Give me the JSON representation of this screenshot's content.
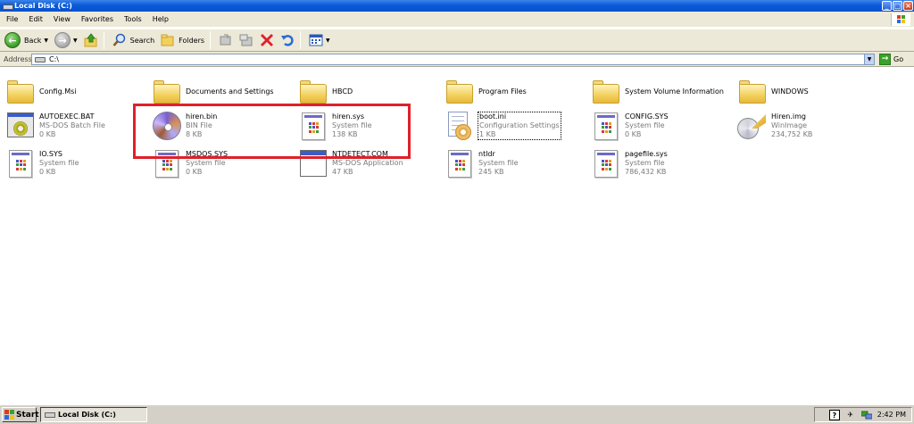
{
  "window": {
    "title": "Local Disk (C:)"
  },
  "menu": [
    "File",
    "Edit",
    "View",
    "Favorites",
    "Tools",
    "Help"
  ],
  "toolbar": {
    "back_label": "Back",
    "search_label": "Search",
    "folders_label": "Folders"
  },
  "address": {
    "label": "Address",
    "value": "C:\\",
    "go_label": "Go"
  },
  "folders": [
    {
      "name": "Config.Msi"
    },
    {
      "name": "Documents and Settings"
    },
    {
      "name": "HBCD"
    },
    {
      "name": "Program Files"
    },
    {
      "name": "System Volume Information"
    },
    {
      "name": "WINDOWS"
    }
  ],
  "files": [
    {
      "name": "AUTOEXEC.BAT",
      "type": "MS-DOS Batch File",
      "size": "0 KB",
      "icon": "batch-file-icon"
    },
    {
      "name": "hiren.bin",
      "type": "BIN File",
      "size": "8 KB",
      "icon": "disc-image-icon"
    },
    {
      "name": "hiren.sys",
      "type": "System file",
      "size": "138 KB",
      "icon": "system-file-icon"
    },
    {
      "name": "boot.ini",
      "type": "Configuration Settings",
      "size": "1 KB",
      "icon": "config-file-icon"
    },
    {
      "name": "CONFIG.SYS",
      "type": "System file",
      "size": "0 KB",
      "icon": "system-file-icon"
    },
    {
      "name": "Hiren.img",
      "type": "WinImage",
      "size": "234,752 KB",
      "icon": "winimage-icon"
    },
    {
      "name": "IO.SYS",
      "type": "System file",
      "size": "0 KB",
      "icon": "system-file-icon"
    },
    {
      "name": "MSDOS.SYS",
      "type": "System file",
      "size": "0 KB",
      "icon": "system-file-icon"
    },
    {
      "name": "NTDETECT.COM",
      "type": "MS-DOS Application",
      "size": "47 KB",
      "icon": "application-icon"
    },
    {
      "name": "ntldr",
      "type": "System file",
      "size": "245 KB",
      "icon": "system-file-icon"
    },
    {
      "name": "pagefile.sys",
      "type": "System file",
      "size": "786,432 KB",
      "icon": "system-file-icon"
    }
  ],
  "taskbar": {
    "start_label": "Start",
    "task_label": "Local Disk (C:)",
    "clock": "2:42 PM"
  },
  "colors": {
    "annotation": "#e0202a",
    "titlebar": "#0a5ad8",
    "chrome": "#ece9d8"
  }
}
